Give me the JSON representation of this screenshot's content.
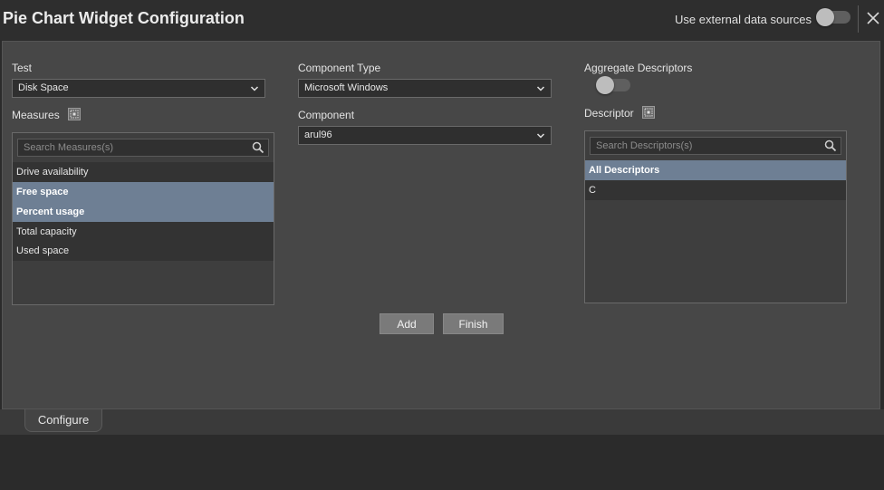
{
  "header": {
    "title": "Pie Chart Widget Configuration",
    "external_sources_label": "Use external data sources",
    "external_sources_enabled": false
  },
  "test": {
    "label": "Test",
    "value": "Disk Space"
  },
  "component_type": {
    "label": "Component Type",
    "value": "Microsoft Windows"
  },
  "component": {
    "label": "Component",
    "value": "arul96"
  },
  "aggregate": {
    "label": "Aggregate Descriptors",
    "enabled": false
  },
  "measures": {
    "label": "Measures",
    "search_placeholder": "Search Measures(s)",
    "items": [
      {
        "label": "Drive availability",
        "selected": false
      },
      {
        "label": "Free space",
        "selected": true
      },
      {
        "label": "Percent usage",
        "selected": true
      },
      {
        "label": "Total capacity",
        "selected": false
      },
      {
        "label": "Used space",
        "selected": false
      }
    ]
  },
  "descriptor": {
    "label": "Descriptor",
    "search_placeholder": "Search Descriptors(s)",
    "items": [
      {
        "label": "All Descriptors",
        "selected": true
      },
      {
        "label": "C",
        "selected": false
      }
    ]
  },
  "buttons": {
    "add": "Add",
    "finish": "Finish"
  },
  "tabs": {
    "configure": "Configure"
  },
  "colors": {
    "selected_row": "#6e7f94",
    "panel": "#474747"
  }
}
